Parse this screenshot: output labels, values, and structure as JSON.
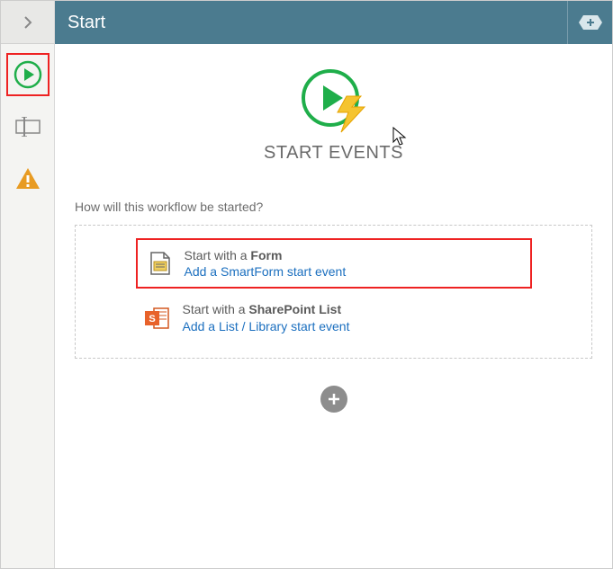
{
  "header": {
    "title": "Start"
  },
  "sidebar": {
    "items": [
      {
        "name": "start-events"
      },
      {
        "name": "rename"
      },
      {
        "name": "warnings"
      }
    ]
  },
  "hero": {
    "title": "START EVENTS"
  },
  "prompt": "How will this workflow be started?",
  "options": [
    {
      "title_prefix": "Start with a ",
      "title_bold": "Form",
      "link": "Add a SmartForm start event"
    },
    {
      "title_prefix": "Start with a ",
      "title_bold": "SharePoint List",
      "link": "Add a List / Library start event"
    }
  ]
}
